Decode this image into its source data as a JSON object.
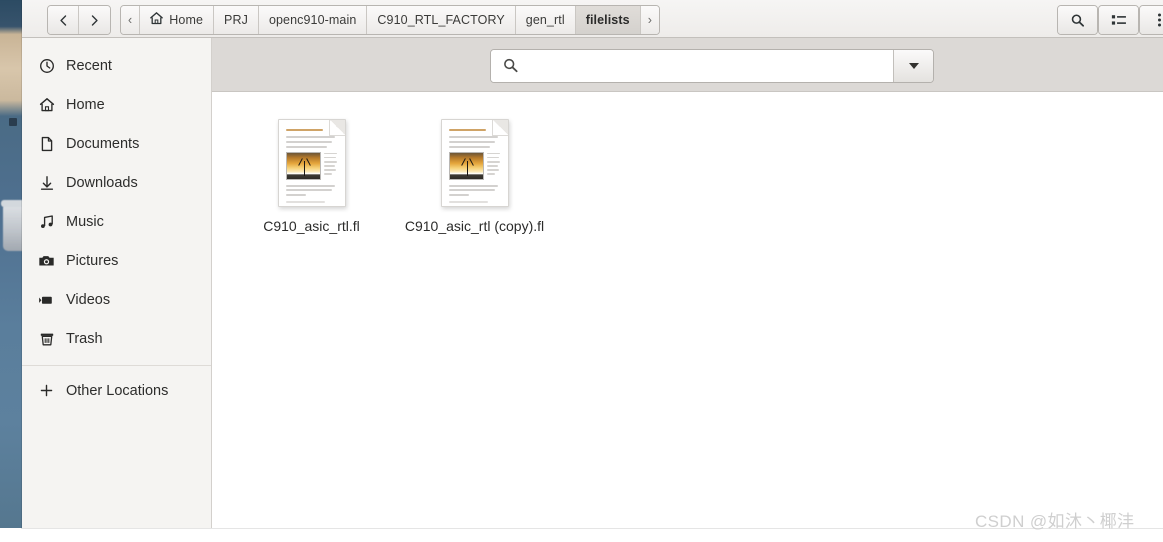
{
  "window": {
    "title": "filelists"
  },
  "header": {
    "nav": [
      {
        "name": "back",
        "glyph": "chevron-left"
      },
      {
        "name": "forward",
        "glyph": "chevron-right"
      }
    ],
    "breadcrumb": {
      "left_arrow": "‹",
      "right_arrow": "›",
      "items": [
        {
          "label": "Home",
          "icon": "home-icon",
          "current": false
        },
        {
          "label": "PRJ",
          "current": false
        },
        {
          "label": "openc910-main",
          "current": false
        },
        {
          "label": "C910_RTL_FACTORY",
          "current": false
        },
        {
          "label": "gen_rtl",
          "current": false
        },
        {
          "label": "filelists",
          "current": true
        }
      ]
    },
    "actions": [
      {
        "name": "search-toggle-button",
        "icon": "search-icon"
      },
      {
        "name": "view-options-button",
        "icon": "list-view-icon"
      },
      {
        "name": "main-menu-button",
        "icon": "vertical-dots-icon"
      }
    ]
  },
  "sidebar": {
    "items": [
      {
        "label": "Recent",
        "icon": "clock-icon"
      },
      {
        "label": "Home",
        "icon": "home-icon"
      },
      {
        "label": "Documents",
        "icon": "document-icon"
      },
      {
        "label": "Downloads",
        "icon": "download-arrow-icon"
      },
      {
        "label": "Music",
        "icon": "music-note-icon"
      },
      {
        "label": "Pictures",
        "icon": "camera-icon"
      },
      {
        "label": "Videos",
        "icon": "video-camera-icon"
      },
      {
        "label": "Trash",
        "icon": "trash-icon"
      }
    ],
    "other_locations": {
      "label": "Other Locations",
      "icon": "plus-icon"
    }
  },
  "search": {
    "value": "",
    "placeholder": "",
    "icon": "search-icon",
    "dropdown_icon": "chevron-down-icon"
  },
  "files": [
    {
      "name": "C910_asic_rtl.fl",
      "icon": "document-thumbnail-icon"
    },
    {
      "name": "C910_asic_rtl (copy).fl",
      "icon": "document-thumbnail-icon"
    }
  ],
  "watermark": {
    "text": "CSDN @如沐丶椰沣"
  },
  "colors": {
    "header_bg": "#f1efed",
    "sidebar_bg": "#f5f4f2",
    "search_row_bg": "#dcd9d6",
    "content_bg": "#ffffff",
    "watermark": "#cfcfcf"
  }
}
